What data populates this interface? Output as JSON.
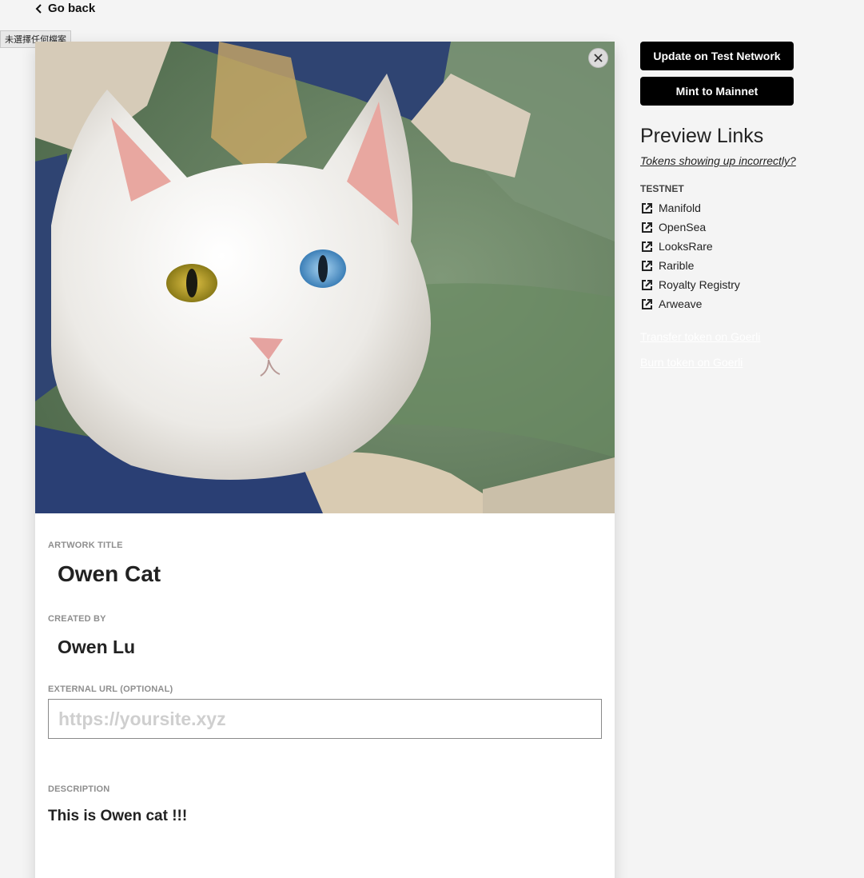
{
  "nav": {
    "go_back_label": "Go back"
  },
  "file_input": {
    "status_text": "未選擇任何檔案"
  },
  "artwork": {
    "subject": "white cat with heterochromatic eyes",
    "close_icon": "close-icon"
  },
  "form": {
    "title_label": "ARTWORK TITLE",
    "title_value": "Owen Cat",
    "creator_label": "CREATED BY",
    "creator_value": "Owen Lu",
    "url_label": "EXTERNAL URL (OPTIONAL)",
    "url_value": "",
    "url_placeholder": "https://yoursite.xyz",
    "description_label": "DESCRIPTION",
    "description_value": "This is Owen cat !!!"
  },
  "actions": {
    "update_label": "Update on Test Network",
    "mint_label": "Mint to Mainnet"
  },
  "preview": {
    "title": "Preview Links",
    "help_link": "Tokens showing up incorrectly?",
    "section_label": "TESTNET",
    "link_icon": "external-link-icon",
    "links": [
      {
        "label": "Manifold"
      },
      {
        "label": "OpenSea"
      },
      {
        "label": "LooksRare"
      },
      {
        "label": "Rarible"
      },
      {
        "label": "Royalty Registry"
      },
      {
        "label": "Arweave"
      }
    ],
    "transfer_label": "Transfer token on Goerli",
    "burn_label": "Burn token on Goerli"
  },
  "colors": {
    "background": "#f4f4f4",
    "button": "#000000",
    "label": "#8e8e8e",
    "placeholder": "#cfcfcf"
  }
}
